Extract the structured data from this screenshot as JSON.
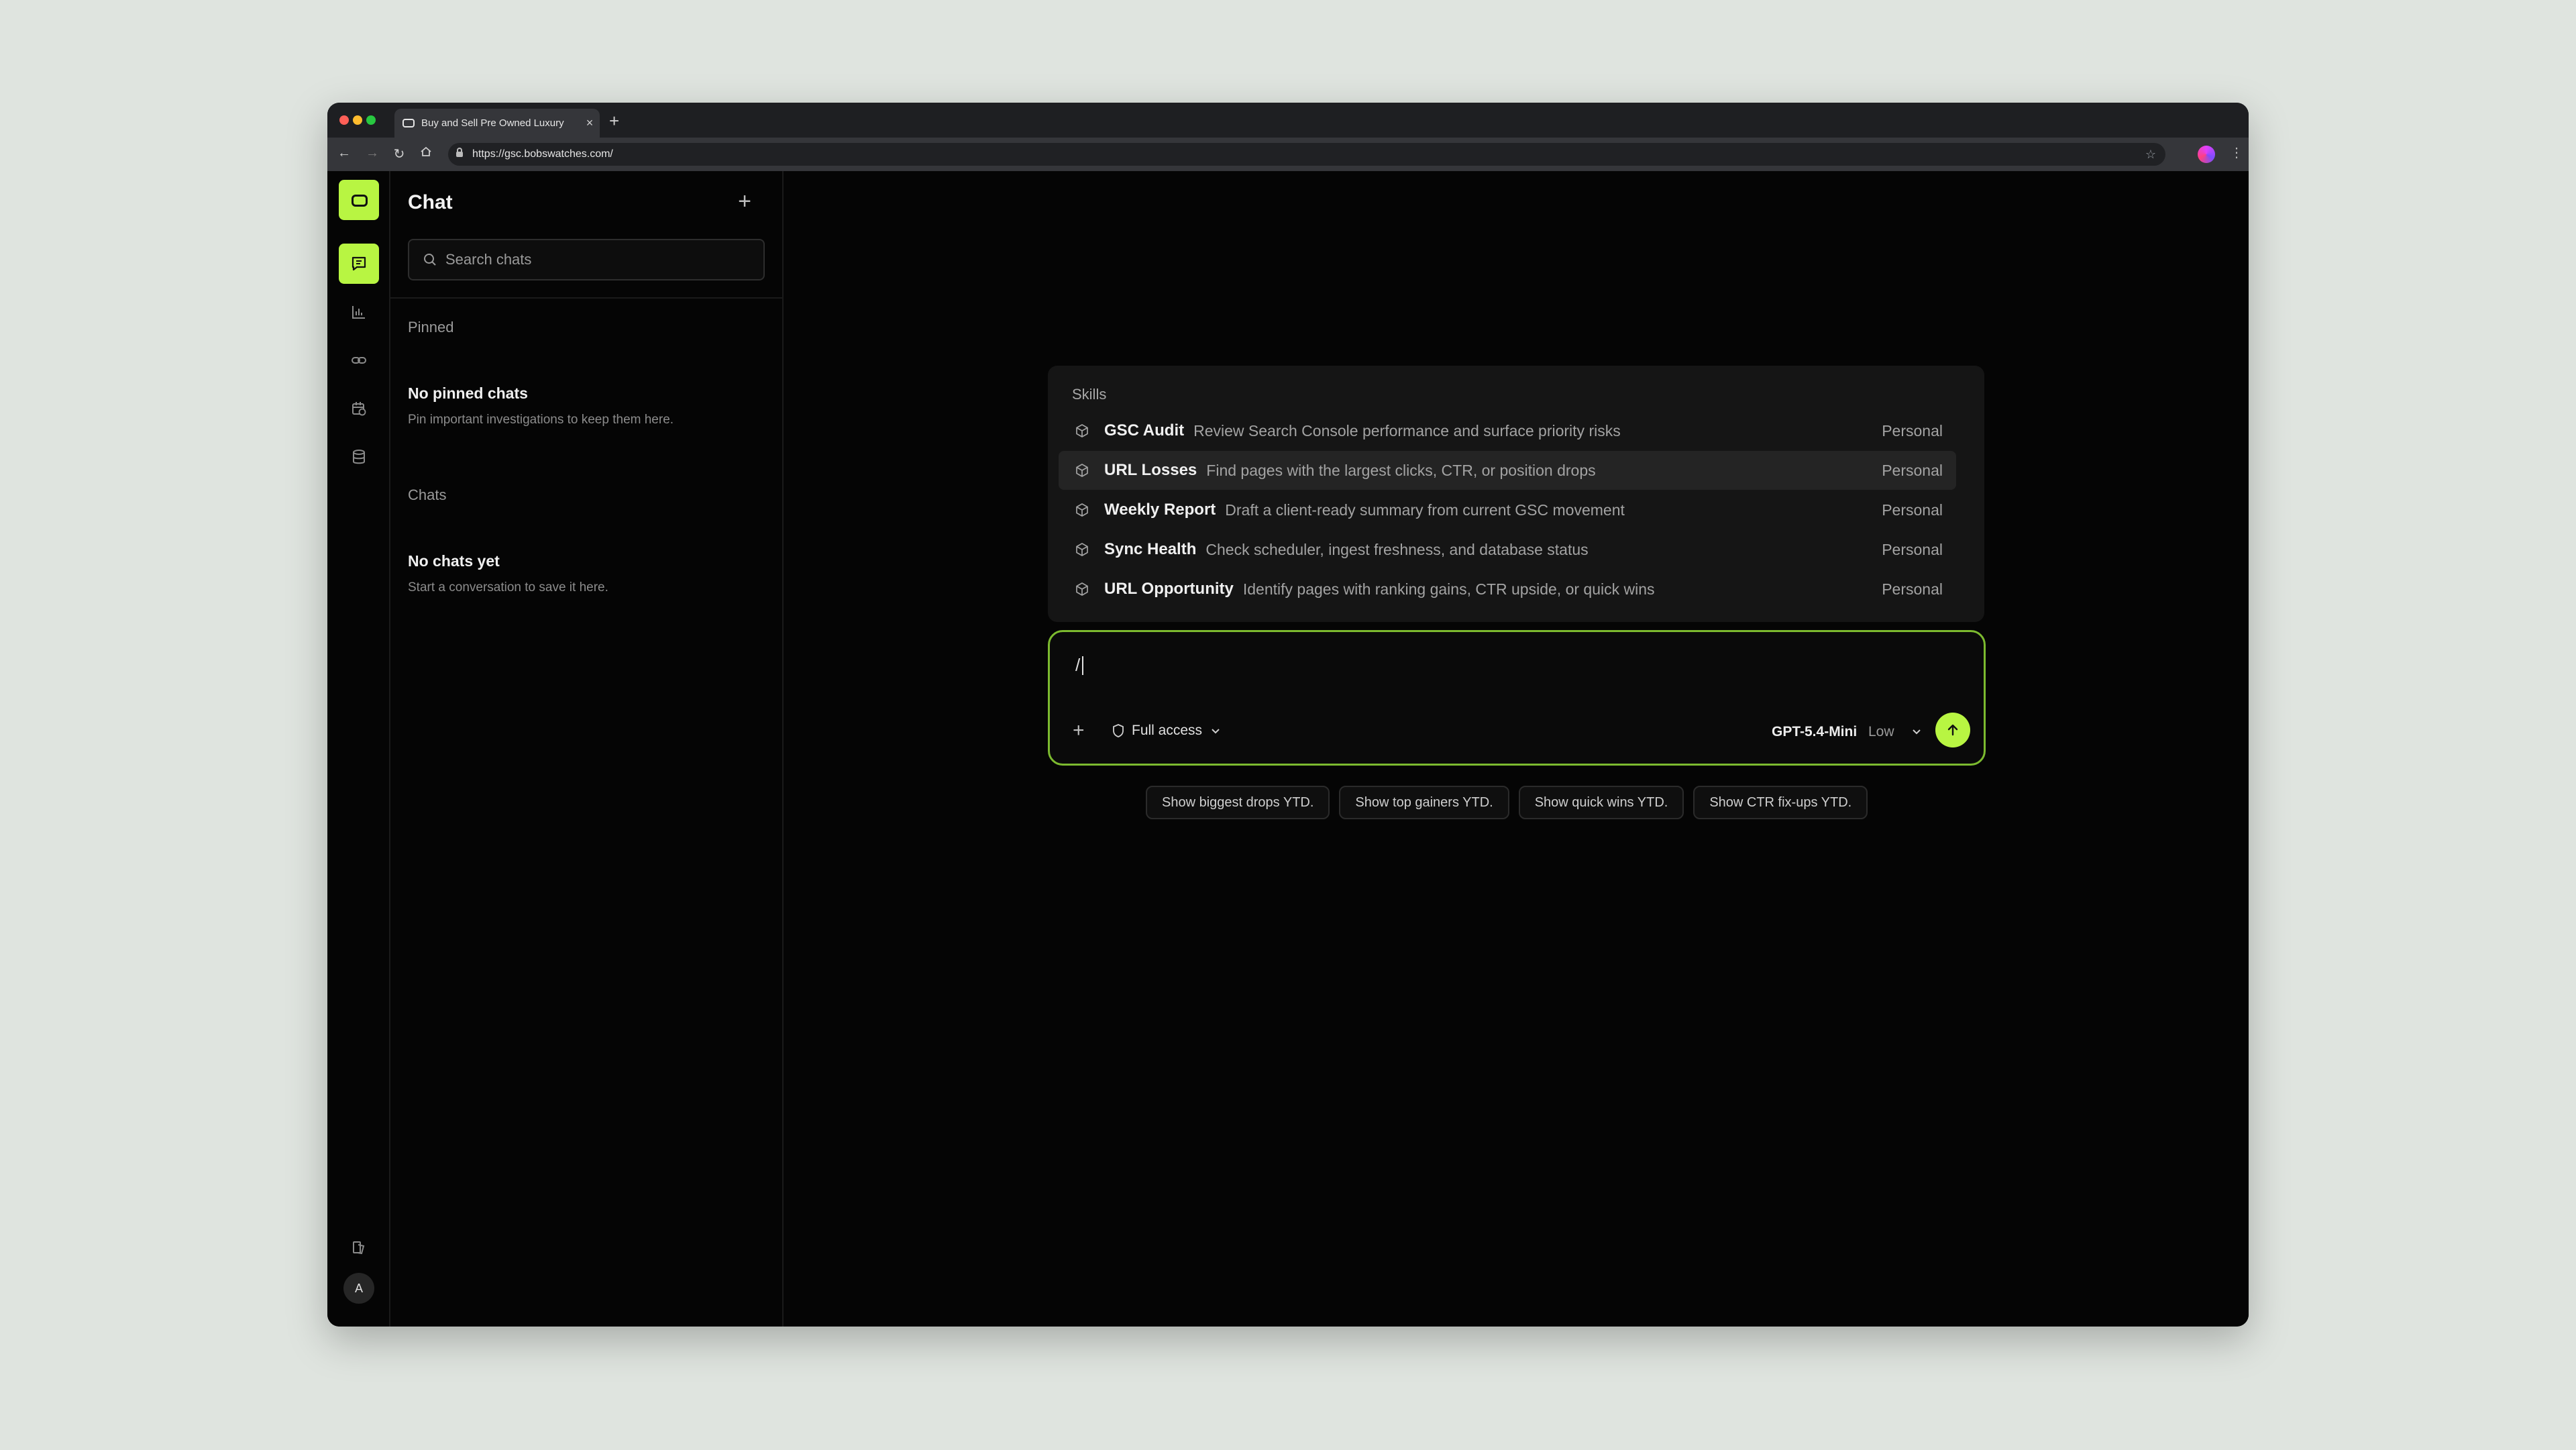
{
  "browser": {
    "tab_title": "Buy and Sell Pre Owned Luxury",
    "url": "https://gsc.bobswatches.com/"
  },
  "rail": {
    "avatar_initial": "A"
  },
  "sidebar": {
    "title": "Chat",
    "search_placeholder": "Search chats",
    "pinned_label": "Pinned",
    "pinned_empty_title": "No pinned chats",
    "pinned_empty_sub": "Pin important investigations to keep them here.",
    "chats_label": "Chats",
    "chats_empty_title": "No chats yet",
    "chats_empty_sub": "Start a conversation to save it here."
  },
  "skills": {
    "title": "Skills",
    "items": [
      {
        "name": "GSC Audit",
        "desc": "Review Search Console performance and surface priority risks",
        "tag": "Personal"
      },
      {
        "name": "URL Losses",
        "desc": "Find pages with the largest clicks, CTR, or position drops",
        "tag": "Personal"
      },
      {
        "name": "Weekly Report",
        "desc": "Draft a client-ready summary from current GSC movement",
        "tag": "Personal"
      },
      {
        "name": "Sync Health",
        "desc": "Check scheduler, ingest freshness, and database status",
        "tag": "Personal"
      },
      {
        "name": "URL Opportunity",
        "desc": "Identify pages with ranking gains, CTR upside, or quick wins",
        "tag": "Personal"
      }
    ]
  },
  "composer": {
    "typed": "/",
    "access_label": "Full access",
    "model": "GPT-5.4-Mini",
    "effort": "Low"
  },
  "suggestions": [
    "Show biggest drops YTD.",
    "Show top gainers YTD.",
    "Show quick wins YTD.",
    "Show CTR fix-ups YTD."
  ],
  "colors": {
    "accent": "#b8f542",
    "composer_border": "#7cba2f",
    "background": "#050505"
  }
}
